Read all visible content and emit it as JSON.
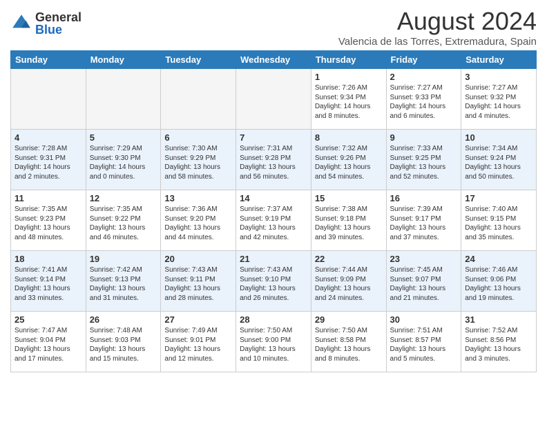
{
  "header": {
    "logo_general": "General",
    "logo_blue": "Blue",
    "month_year": "August 2024",
    "location": "Valencia de las Torres, Extremadura, Spain"
  },
  "days_of_week": [
    "Sunday",
    "Monday",
    "Tuesday",
    "Wednesday",
    "Thursday",
    "Friday",
    "Saturday"
  ],
  "weeks": [
    [
      {
        "day": "",
        "text": ""
      },
      {
        "day": "",
        "text": ""
      },
      {
        "day": "",
        "text": ""
      },
      {
        "day": "",
        "text": ""
      },
      {
        "day": "1",
        "text": "Sunrise: 7:26 AM\nSunset: 9:34 PM\nDaylight: 14 hours and 8 minutes."
      },
      {
        "day": "2",
        "text": "Sunrise: 7:27 AM\nSunset: 9:33 PM\nDaylight: 14 hours and 6 minutes."
      },
      {
        "day": "3",
        "text": "Sunrise: 7:27 AM\nSunset: 9:32 PM\nDaylight: 14 hours and 4 minutes."
      }
    ],
    [
      {
        "day": "4",
        "text": "Sunrise: 7:28 AM\nSunset: 9:31 PM\nDaylight: 14 hours and 2 minutes."
      },
      {
        "day": "5",
        "text": "Sunrise: 7:29 AM\nSunset: 9:30 PM\nDaylight: 14 hours and 0 minutes."
      },
      {
        "day": "6",
        "text": "Sunrise: 7:30 AM\nSunset: 9:29 PM\nDaylight: 13 hours and 58 minutes."
      },
      {
        "day": "7",
        "text": "Sunrise: 7:31 AM\nSunset: 9:28 PM\nDaylight: 13 hours and 56 minutes."
      },
      {
        "day": "8",
        "text": "Sunrise: 7:32 AM\nSunset: 9:26 PM\nDaylight: 13 hours and 54 minutes."
      },
      {
        "day": "9",
        "text": "Sunrise: 7:33 AM\nSunset: 9:25 PM\nDaylight: 13 hours and 52 minutes."
      },
      {
        "day": "10",
        "text": "Sunrise: 7:34 AM\nSunset: 9:24 PM\nDaylight: 13 hours and 50 minutes."
      }
    ],
    [
      {
        "day": "11",
        "text": "Sunrise: 7:35 AM\nSunset: 9:23 PM\nDaylight: 13 hours and 48 minutes."
      },
      {
        "day": "12",
        "text": "Sunrise: 7:35 AM\nSunset: 9:22 PM\nDaylight: 13 hours and 46 minutes."
      },
      {
        "day": "13",
        "text": "Sunrise: 7:36 AM\nSunset: 9:20 PM\nDaylight: 13 hours and 44 minutes."
      },
      {
        "day": "14",
        "text": "Sunrise: 7:37 AM\nSunset: 9:19 PM\nDaylight: 13 hours and 42 minutes."
      },
      {
        "day": "15",
        "text": "Sunrise: 7:38 AM\nSunset: 9:18 PM\nDaylight: 13 hours and 39 minutes."
      },
      {
        "day": "16",
        "text": "Sunrise: 7:39 AM\nSunset: 9:17 PM\nDaylight: 13 hours and 37 minutes."
      },
      {
        "day": "17",
        "text": "Sunrise: 7:40 AM\nSunset: 9:15 PM\nDaylight: 13 hours and 35 minutes."
      }
    ],
    [
      {
        "day": "18",
        "text": "Sunrise: 7:41 AM\nSunset: 9:14 PM\nDaylight: 13 hours and 33 minutes."
      },
      {
        "day": "19",
        "text": "Sunrise: 7:42 AM\nSunset: 9:13 PM\nDaylight: 13 hours and 31 minutes."
      },
      {
        "day": "20",
        "text": "Sunrise: 7:43 AM\nSunset: 9:11 PM\nDaylight: 13 hours and 28 minutes."
      },
      {
        "day": "21",
        "text": "Sunrise: 7:43 AM\nSunset: 9:10 PM\nDaylight: 13 hours and 26 minutes."
      },
      {
        "day": "22",
        "text": "Sunrise: 7:44 AM\nSunset: 9:09 PM\nDaylight: 13 hours and 24 minutes."
      },
      {
        "day": "23",
        "text": "Sunrise: 7:45 AM\nSunset: 9:07 PM\nDaylight: 13 hours and 21 minutes."
      },
      {
        "day": "24",
        "text": "Sunrise: 7:46 AM\nSunset: 9:06 PM\nDaylight: 13 hours and 19 minutes."
      }
    ],
    [
      {
        "day": "25",
        "text": "Sunrise: 7:47 AM\nSunset: 9:04 PM\nDaylight: 13 hours and 17 minutes."
      },
      {
        "day": "26",
        "text": "Sunrise: 7:48 AM\nSunset: 9:03 PM\nDaylight: 13 hours and 15 minutes."
      },
      {
        "day": "27",
        "text": "Sunrise: 7:49 AM\nSunset: 9:01 PM\nDaylight: 13 hours and 12 minutes."
      },
      {
        "day": "28",
        "text": "Sunrise: 7:50 AM\nSunset: 9:00 PM\nDaylight: 13 hours and 10 minutes."
      },
      {
        "day": "29",
        "text": "Sunrise: 7:50 AM\nSunset: 8:58 PM\nDaylight: 13 hours and 8 minutes."
      },
      {
        "day": "30",
        "text": "Sunrise: 7:51 AM\nSunset: 8:57 PM\nDaylight: 13 hours and 5 minutes."
      },
      {
        "day": "31",
        "text": "Sunrise: 7:52 AM\nSunset: 8:56 PM\nDaylight: 13 hours and 3 minutes."
      }
    ]
  ]
}
